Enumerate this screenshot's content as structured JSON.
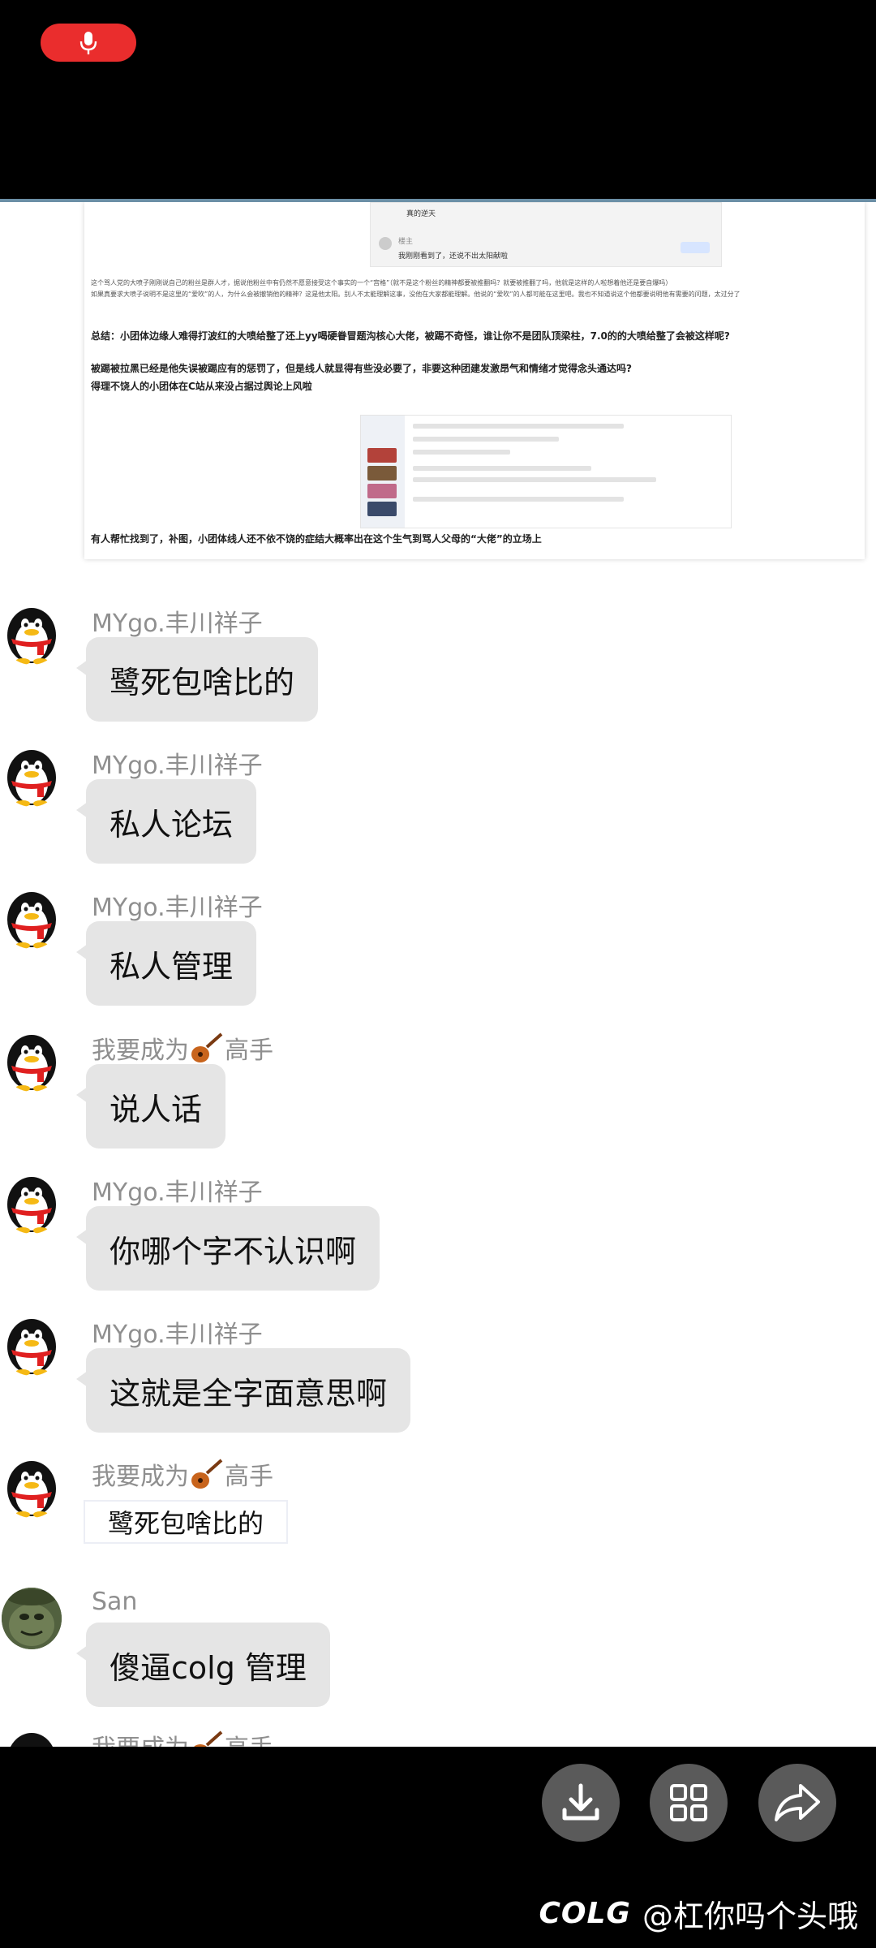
{
  "screenshot_preview": {
    "reply_lines": [
      "真的逆天",
      "楼主",
      "我刚刚看到了，还说不出太阳献啦"
    ],
    "paragraph1": "这个骂人党的大喷子刚刚说自己的粉丝是群人才，据说他粉丝中有仍然不愿意接受这个事实的一个“宫格”（就不是这个粉丝的精神都要被推翻吗？就要被推翻了吗，他就是这样的人啦想着他还是要自爆吗）",
    "paragraph2": "如果真要求大喷子说明不是这里的“爱吹”的人，为什么会被撤销他的精神？这是他太阳。别人不太能理解这事，没他在大家都能理解。他说的“爱吹”的人都可能在这里吧。我也不知道说这个他都要说明他有需要的问题，太过分了",
    "bold1": "总结：小团体边缘人难得打波红的大喷给整了还上yy喝硬眷冒题沟核心大佬，被踢不奇怪，谁让你不是团队顶梁柱，7.0的的大喷给整了会被这样呢?",
    "bold2": "被踢被拉黑已经是他失误被踢应有的惩罚了，但是线人就显得有些没必要了，非要这种团建发激昂气和情绪才觉得念头通达吗?",
    "bold3": "得理不饶人的小团体在C站从来没占据过舆论上风啦",
    "footer": "有人帮忙找到了，补图，小团体线人还不依不饶的症结大概率出在这个生气到骂人父母的“大佬”的立场上"
  },
  "messages": [
    {
      "sender": "MYgo.丰川祥子",
      "text": "鹭死包啥比的"
    },
    {
      "sender": "MYgo.丰川祥子",
      "text": "私人论坛"
    },
    {
      "sender": "MYgo.丰川祥子",
      "text": "私人管理"
    },
    {
      "sender_prefix": "我要成为",
      "sender_suffix": "高手",
      "text": "说人话"
    },
    {
      "sender": "MYgo.丰川祥子",
      "text": "你哪个字不认识啊"
    },
    {
      "sender": "MYgo.丰川祥子",
      "text": "这就是全字面意思啊"
    },
    {
      "sender_prefix": "我要成为",
      "sender_suffix": "高手",
      "text": "鹭死包啥比的"
    },
    {
      "sender": "San",
      "text": "傻逼colg 管理"
    },
    {
      "sender_prefix": "我要成为",
      "sender_suffix": "高手"
    }
  ],
  "actions": {
    "download_icon": "download-icon",
    "grid_icon": "grid-icon",
    "share_icon": "share-icon"
  },
  "watermark": {
    "logo": "COLG",
    "handle": "@杠你吗个头哦"
  },
  "colors": {
    "record_pill": "#ea2d2d",
    "bubble": "#e5e5e5",
    "sender": "#8f8f8f",
    "button_bg": "#5a5a5a"
  }
}
